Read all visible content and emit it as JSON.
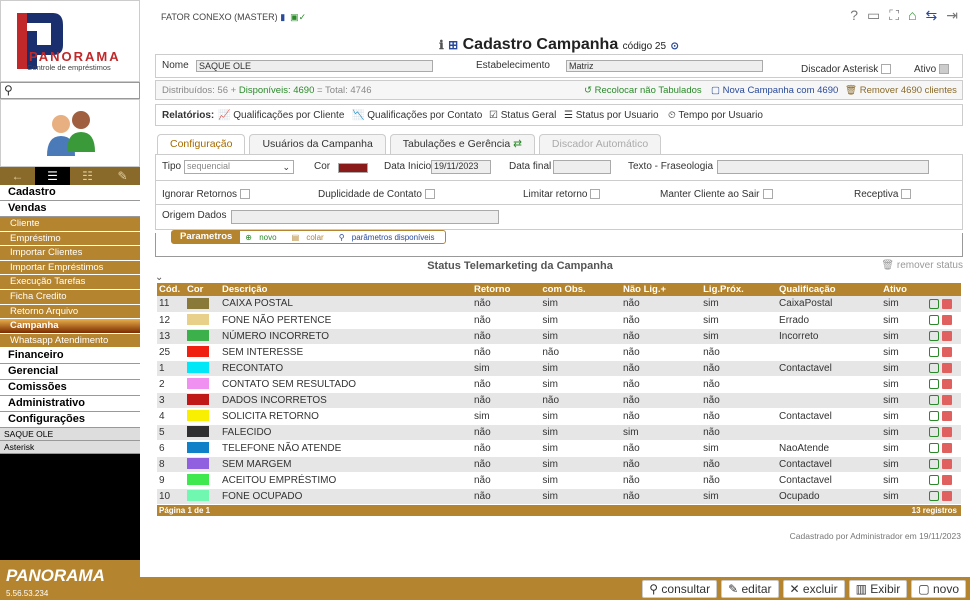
{
  "brand": {
    "name": "PANORAMA",
    "tagline": "Controle de empréstimos",
    "version": "5.56.53.234"
  },
  "sidebar": {
    "tabs": [
      "←",
      "☰",
      "☷",
      "✎"
    ],
    "menu": [
      {
        "type": "group",
        "label": "Cadastro"
      },
      {
        "type": "group",
        "label": "Vendas"
      },
      {
        "type": "sub",
        "label": "Cliente"
      },
      {
        "type": "sub",
        "label": "Empréstimo"
      },
      {
        "type": "sub",
        "label": "Importar Clientes"
      },
      {
        "type": "sub",
        "label": "Importar Empréstimos"
      },
      {
        "type": "sub",
        "label": "Execução Tarefas"
      },
      {
        "type": "sub",
        "label": "Ficha Credito"
      },
      {
        "type": "sub",
        "label": "Retorno Arquivo"
      },
      {
        "type": "sub",
        "label": "Campanha",
        "active": true
      },
      {
        "type": "sub",
        "label": "Whatsapp Atendimento"
      },
      {
        "type": "group",
        "label": "Financeiro"
      },
      {
        "type": "group",
        "label": "Gerencial"
      },
      {
        "type": "group",
        "label": "Comissões"
      },
      {
        "type": "group",
        "label": "Administrativo"
      },
      {
        "type": "group",
        "label": "Configurações"
      },
      {
        "type": "info",
        "label": "SAQUE OLE"
      },
      {
        "type": "info",
        "label": "Asterisk"
      }
    ]
  },
  "header": {
    "company": "FATOR CONEXO (MASTER)",
    "title": "Cadastro Campanha",
    "code": "código 25"
  },
  "form": {
    "nome_label": "Nome",
    "nome_value": "SAQUE OLE",
    "estab_label": "Estabelecimento",
    "estab_value": "Matriz",
    "discador_label": "Discador Asterisk",
    "ativo_label": "Ativo"
  },
  "distribution": {
    "text_prefix": "Distribuídos: 56 + ",
    "disp_label": "Disponíveis: 4690",
    "text_suffix": " = Total: 4746",
    "recolocar": "Recolocar não Tabulados",
    "nova": "Nova Campanha com 4690",
    "remover": "Remover 4690 clientes"
  },
  "reports": {
    "label": "Relatórios:",
    "items": [
      "Qualificações por Cliente",
      "Qualificações por Contato",
      "Status Geral",
      "Status por Usuario",
      "Tempo por Usuario"
    ]
  },
  "tabs": [
    "Configuração",
    "Usuários da Campanha",
    "Tabulações e Gerência",
    "Discador Automático"
  ],
  "config": {
    "tipo_label": "Tipo",
    "tipo_value": "sequencial",
    "cor_label": "Cor",
    "cor_value": "#8a1a1a",
    "data_inicio_label": "Data Inicio",
    "data_inicio": "19/11/2023",
    "data_final_label": "Data final",
    "fraseologia_label": "Texto - Fraseologia",
    "ignorar": "Ignorar Retornos",
    "duplicidade": "Duplicidade de Contato",
    "limitar": "Limitar retorno",
    "manter": "Manter Cliente ao Sair",
    "receptiva": "Receptiva",
    "origem_label": "Origem Dados"
  },
  "params": {
    "title": "Parametros",
    "novo": "novo",
    "colar": "colar",
    "disp": "parâmetros disponíveis"
  },
  "status": {
    "title": "Status Telemarketing da Campanha",
    "remove": "remover status",
    "headers": [
      "Cód.",
      "Cor",
      "Descrição",
      "Retorno",
      "com Obs.",
      "Não Lig.+",
      "Lig.Próx.",
      "Qualificação",
      "Ativo"
    ],
    "rows": [
      [
        "11",
        "#8a7a3a",
        "CAIXA POSTAL",
        "não",
        "sim",
        "não",
        "sim",
        "CaixaPostal",
        "sim"
      ],
      [
        "12",
        "#e8d08a",
        "FONE NÃO PERTENCE",
        "não",
        "sim",
        "não",
        "sim",
        "Errado",
        "sim"
      ],
      [
        "13",
        "#3cb04a",
        "NÚMERO INCORRETO",
        "não",
        "sim",
        "não",
        "sim",
        "Incorreto",
        "sim"
      ],
      [
        "25",
        "#f02010",
        "SEM INTERESSE",
        "não",
        "não",
        "não",
        "não",
        "",
        "sim"
      ],
      [
        "1",
        "#00e8f8",
        "RECONTATO",
        "sim",
        "sim",
        "não",
        "não",
        "Contactavel",
        "sim"
      ],
      [
        "2",
        "#f090f0",
        "CONTATO SEM RESULTADO",
        "não",
        "sim",
        "não",
        "não",
        "",
        "sim"
      ],
      [
        "3",
        "#c01818",
        "DADOS INCORRETOS",
        "não",
        "não",
        "não",
        "não",
        "",
        "sim"
      ],
      [
        "4",
        "#f8f000",
        "SOLICITA RETORNO",
        "sim",
        "sim",
        "não",
        "não",
        "Contactavel",
        "sim"
      ],
      [
        "5",
        "#303030",
        "FALECIDO",
        "não",
        "sim",
        "sim",
        "não",
        "",
        "sim"
      ],
      [
        "6",
        "#1080c8",
        "TELEFONE NÃO ATENDE",
        "não",
        "sim",
        "não",
        "sim",
        "NaoAtende",
        "sim"
      ],
      [
        "8",
        "#9060e0",
        "SEM MARGEM",
        "não",
        "sim",
        "não",
        "não",
        "Contactavel",
        "sim"
      ],
      [
        "9",
        "#40e850",
        "ACEITOU EMPRÉSTIMO",
        "não",
        "sim",
        "não",
        "não",
        "Contactavel",
        "sim"
      ],
      [
        "10",
        "#70f8b0",
        "FONE OCUPADO",
        "não",
        "sim",
        "não",
        "sim",
        "Ocupado",
        "sim"
      ]
    ],
    "pager": "Página 1 de 1",
    "count": "13 registros"
  },
  "footer_info": "Cadastrado por Administrador em 19/11/2023",
  "actions": [
    "consultar",
    "editar",
    "excluir",
    "Exibir",
    "novo"
  ],
  "colors": {
    "accent": "#b5842e",
    "brand_red": "#c0282a",
    "brand_blue": "#1a2f6e"
  }
}
